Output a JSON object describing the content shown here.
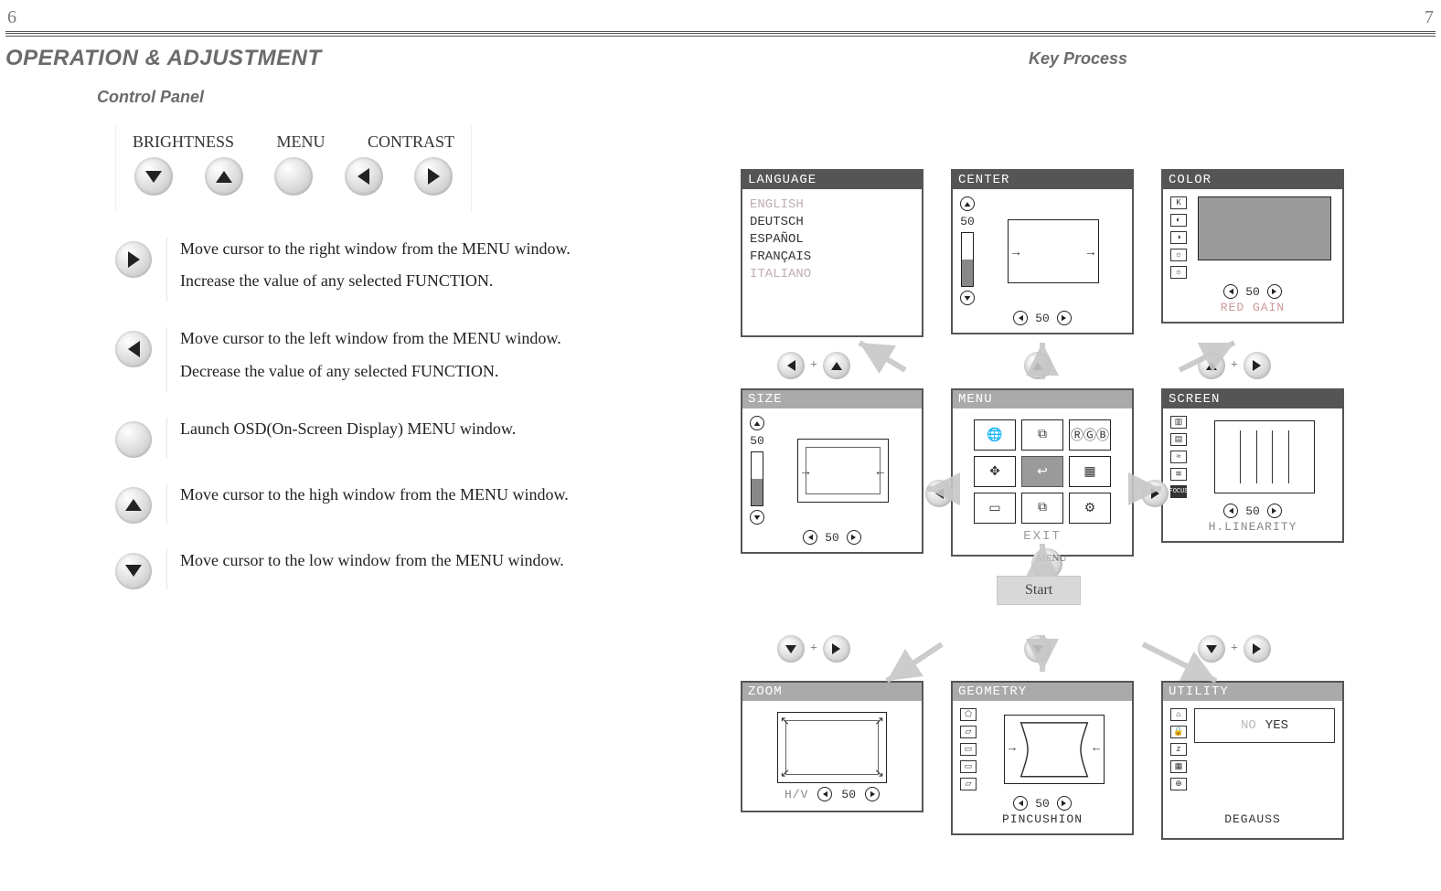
{
  "page_numbers": {
    "left": "6",
    "right": "7"
  },
  "left": {
    "heading": "OPERATION & ADJUSTMENT",
    "subheading": "Control Panel",
    "panel_labels": {
      "brightness": "BRIGHTNESS",
      "menu": "MENU",
      "contrast": "CONTRAST"
    },
    "rows": {
      "r1a": "Move cursor to the right window from the MENU window.",
      "r1b": "Increase the value of any selected FUNCTION.",
      "r2a": "Move cursor to the left window from the MENU window.",
      "r2b": "Decrease the value of any selected FUNCTION.",
      "r3": "Launch OSD(On-Screen Display) MENU window.",
      "r4": "Move cursor to the high window from the MENU window.",
      "r5": "Move cursor to the low window from the MENU window."
    }
  },
  "right": {
    "heading": "Key Process",
    "start": "Start",
    "menu_btn": "MENU",
    "plus": "+",
    "osd": {
      "language": {
        "title": "LANGUAGE",
        "items": [
          "ENGLISH",
          "DEUTSCH",
          "ESPAÑOL",
          "FRANÇAIS",
          "ITALIANO"
        ]
      },
      "center": {
        "title": "CENTER",
        "v": "50",
        "h": "50"
      },
      "color": {
        "title": "COLOR",
        "h": "50",
        "sub": "RED GAIN"
      },
      "size": {
        "title": "SIZE",
        "v": "50",
        "h": "50"
      },
      "menu": {
        "title": "MENU",
        "exit": "EXIT"
      },
      "screen": {
        "title": "SCREEN",
        "h": "50",
        "sub": "H.LINEARITY"
      },
      "zoom": {
        "title": "ZOOM",
        "h": "50",
        "sub": "H/V"
      },
      "geometry": {
        "title": "GEOMETRY",
        "h": "50",
        "sub": "PINCUSHION"
      },
      "utility": {
        "title": "UTILITY",
        "no": "NO",
        "yes": "YES",
        "sub": "DEGAUSS"
      }
    }
  }
}
